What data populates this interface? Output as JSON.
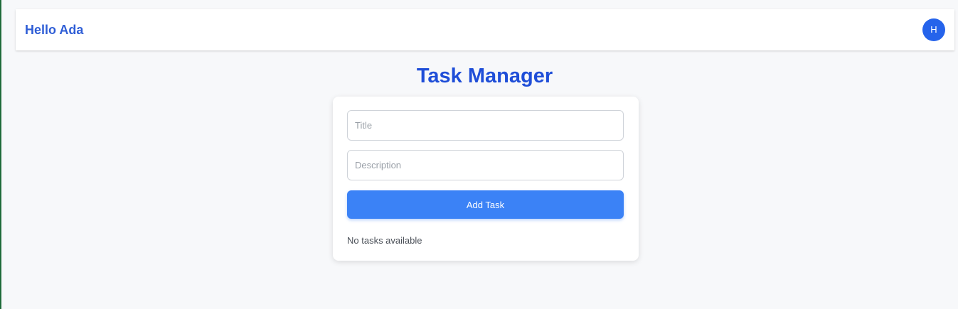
{
  "header": {
    "greeting": "Hello Ada",
    "avatar_initial": "H"
  },
  "main": {
    "title": "Task Manager",
    "form": {
      "title_field": {
        "value": "",
        "placeholder": "Title"
      },
      "description_field": {
        "value": "",
        "placeholder": "Description"
      },
      "submit_label": "Add Task"
    },
    "empty_message": "No tasks available"
  },
  "colors": {
    "accent": "#2563eb",
    "button": "#3b82f6",
    "title": "#1f4ed8",
    "background": "#f7f8fa"
  }
}
